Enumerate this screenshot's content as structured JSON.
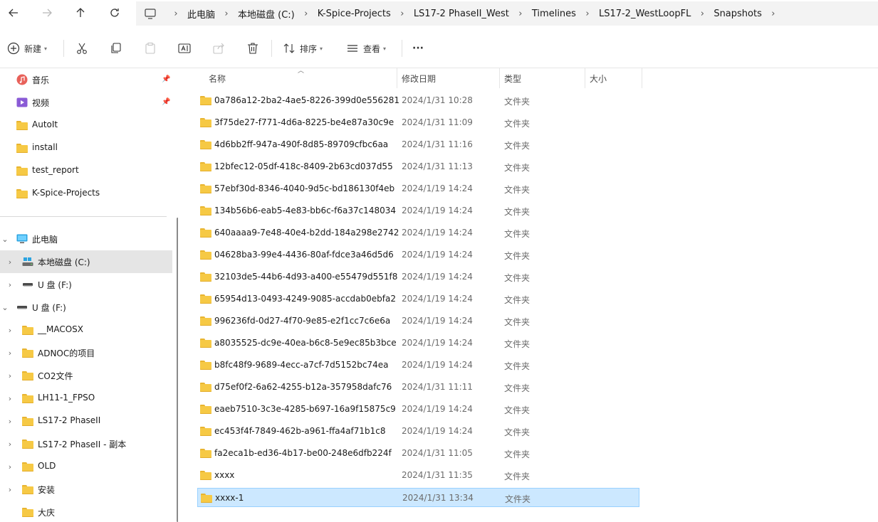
{
  "address_bar": {
    "crumbs": [
      "此电脑",
      "本地磁盘 (C:)",
      "K-Spice-Projects",
      "LS17-2 PhaseII_West",
      "Timelines",
      "LS17-2_WestLoopFL",
      "Snapshots"
    ]
  },
  "toolbar": {
    "new_label": "新建",
    "sort_label": "排序",
    "view_label": "查看",
    "more_label": "···"
  },
  "sidebar": {
    "quick": [
      {
        "label": "音乐",
        "icon": "music-icon",
        "pinned": true
      },
      {
        "label": "视频",
        "icon": "video-icon",
        "pinned": true
      },
      {
        "label": "AutoIt",
        "icon": "folder-icon"
      },
      {
        "label": "install",
        "icon": "folder-icon"
      },
      {
        "label": "test_report",
        "icon": "folder-icon"
      },
      {
        "label": "K-Spice-Projects",
        "icon": "folder-icon"
      }
    ],
    "tree": [
      {
        "label": "此电脑",
        "icon": "computer-icon",
        "expanded": true,
        "level": 0
      },
      {
        "label": "本地磁盘 (C:)",
        "icon": "drive-icon",
        "level": 1,
        "selected": true
      },
      {
        "label": "U 盘 (F:)",
        "icon": "usb-drive-icon",
        "level": 1
      },
      {
        "label": "U 盘 (F:)",
        "icon": "usb-drive-icon",
        "expanded": true,
        "level": 0
      },
      {
        "label": "__MACOSX",
        "icon": "folder-icon",
        "level": 1
      },
      {
        "label": "ADNOC的项目",
        "icon": "folder-icon",
        "level": 1
      },
      {
        "label": "CO2文件",
        "icon": "folder-icon",
        "level": 1
      },
      {
        "label": "LH11-1_FPSO",
        "icon": "folder-icon",
        "level": 1
      },
      {
        "label": "LS17-2 PhaseII",
        "icon": "folder-icon",
        "level": 1
      },
      {
        "label": "LS17-2 PhaseII - 副本",
        "icon": "folder-icon",
        "level": 1
      },
      {
        "label": "OLD",
        "icon": "folder-icon",
        "level": 1
      },
      {
        "label": "安装",
        "icon": "folder-icon",
        "level": 1
      },
      {
        "label": "大庆",
        "icon": "folder-icon",
        "level": 1
      }
    ]
  },
  "filelist": {
    "columns": [
      "名称",
      "修改日期",
      "类型",
      "大小"
    ],
    "rows": [
      {
        "name": "0a786a12-2ba2-4ae5-8226-399d0e556281",
        "date": "2024/1/31 10:28",
        "type": "文件夹"
      },
      {
        "name": "3f75de27-f771-4d6a-8225-be4e87a30c9e",
        "date": "2024/1/31 11:09",
        "type": "文件夹"
      },
      {
        "name": "4d6bb2ff-947a-490f-8d85-89709cfbc6aa",
        "date": "2024/1/31 11:16",
        "type": "文件夹"
      },
      {
        "name": "12bfec12-05df-418c-8409-2b63cd037d55",
        "date": "2024/1/31 11:13",
        "type": "文件夹"
      },
      {
        "name": "57ebf30d-8346-4040-9d5c-bd186130f4eb",
        "date": "2024/1/19 14:24",
        "type": "文件夹"
      },
      {
        "name": "134b56b6-eab5-4e83-bb6c-f6a37c148034",
        "date": "2024/1/19 14:24",
        "type": "文件夹"
      },
      {
        "name": "640aaaa9-7e48-40e4-b2dd-184a298e2742",
        "date": "2024/1/19 14:24",
        "type": "文件夹"
      },
      {
        "name": "04628ba3-99e4-4436-80af-fdce3a46d5d6",
        "date": "2024/1/19 14:24",
        "type": "文件夹"
      },
      {
        "name": "32103de5-44b6-4d93-a400-e55479d551f8",
        "date": "2024/1/19 14:24",
        "type": "文件夹"
      },
      {
        "name": "65954d13-0493-4249-9085-accdab0ebfa2",
        "date": "2024/1/19 14:24",
        "type": "文件夹"
      },
      {
        "name": "996236fd-0d27-4f70-9e85-e2f1cc7c6e6a",
        "date": "2024/1/19 14:24",
        "type": "文件夹"
      },
      {
        "name": "a8035525-dc9e-40ea-b6c8-5e9ec85b3bce",
        "date": "2024/1/19 14:24",
        "type": "文件夹"
      },
      {
        "name": "b8fc48f9-9689-4ecc-a7cf-7d5152bc74ea",
        "date": "2024/1/19 14:24",
        "type": "文件夹"
      },
      {
        "name": "d75ef0f2-6a62-4255-b12a-357958dafc76",
        "date": "2024/1/31 11:11",
        "type": "文件夹"
      },
      {
        "name": "eaeb7510-3c3e-4285-b697-16a9f15875c9",
        "date": "2024/1/19 14:24",
        "type": "文件夹"
      },
      {
        "name": "ec453f4f-7849-462b-a961-ffa4af71b1c8",
        "date": "2024/1/19 14:24",
        "type": "文件夹"
      },
      {
        "name": "fa2eca1b-ed36-4b17-be00-248e6dfb224f",
        "date": "2024/1/31 11:05",
        "type": "文件夹"
      },
      {
        "name": "xxxx",
        "date": "2024/1/31 11:35",
        "type": "文件夹"
      },
      {
        "name": "xxxx-1",
        "date": "2024/1/31 13:34",
        "type": "文件夹",
        "selected": true
      }
    ]
  },
  "colors": {
    "selection": "#cce8ff",
    "selection_border": "#99d1ff",
    "sidebar_selected": "#e5e5e5",
    "folder": "#f6c945",
    "address_bar_bg": "#f3f3f3"
  }
}
